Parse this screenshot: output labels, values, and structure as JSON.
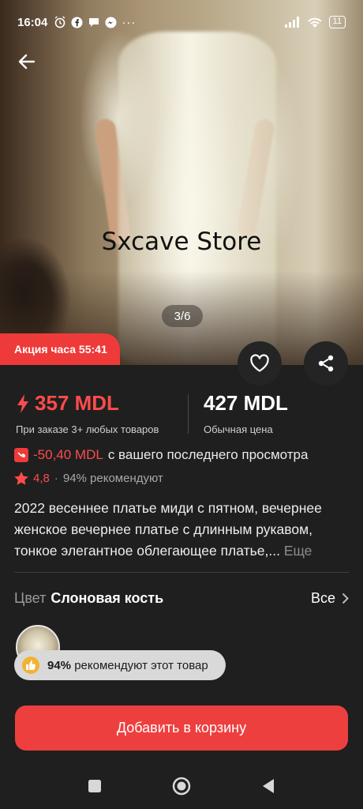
{
  "status_bar": {
    "time": "16:04",
    "battery": "11",
    "notification_icons": [
      "alarm-icon",
      "facebook-icon",
      "chat-icon",
      "messenger-icon",
      "more-dots-icon"
    ]
  },
  "gallery": {
    "watermark": "Sxcave Store",
    "pager": "3/6"
  },
  "promo": {
    "label": "Акция часа 55:41"
  },
  "price": {
    "current": "357 MDL",
    "current_note": "При заказе 3+ любых товаров",
    "regular": "427 MDL",
    "regular_note": "Обычная цена"
  },
  "price_drop": {
    "amount": "-50,40 MDL",
    "text": "с вашего последнего просмотра"
  },
  "rating": {
    "value": "4,8",
    "separator": "·",
    "recommend": "94% рекомендуют"
  },
  "product": {
    "title": "2022 весеннее платье миди с пятном, вечернее женское вечернее платье с длинным рукавом, тонкое элегантное облегающее платье,...",
    "more": "Еще"
  },
  "color": {
    "label": "Цвет",
    "value": "Слоновая кость",
    "all": "Все"
  },
  "recommend_pill": {
    "percent": "94%",
    "text": "рекомендуют этот товар"
  },
  "cart": {
    "label": "Добавить в корзину"
  },
  "colors": {
    "accent": "#ee3f3f",
    "background": "#1f1f1f"
  }
}
